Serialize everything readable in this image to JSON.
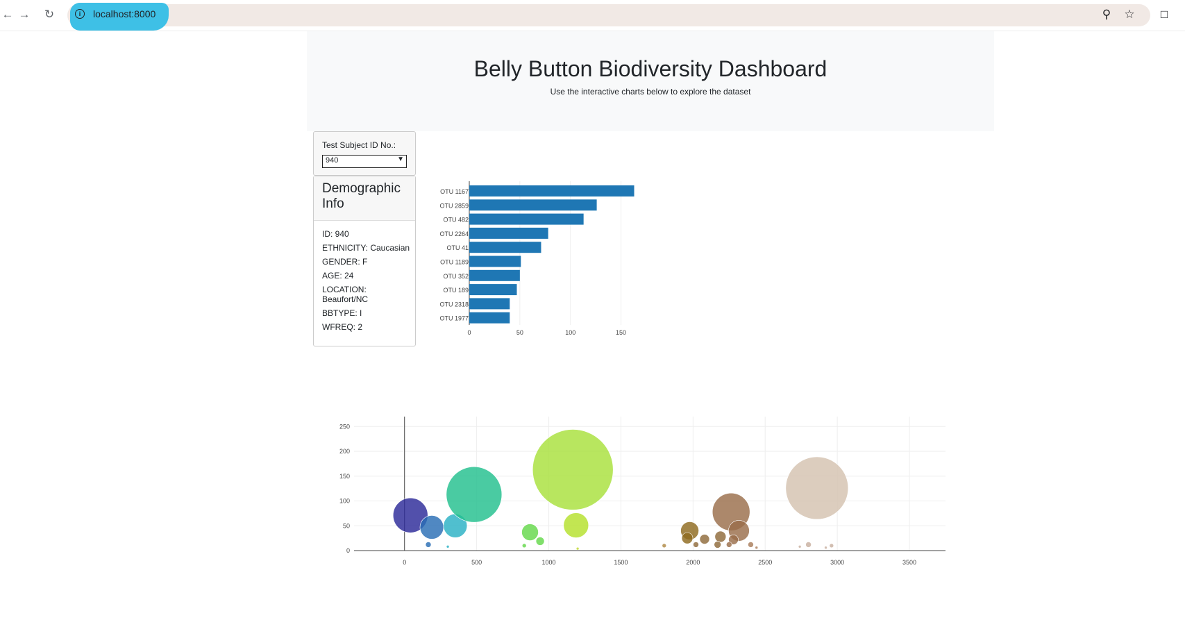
{
  "browser": {
    "url": "localhost:8000",
    "icons": [
      "back-arrow-icon",
      "forward-arrow-icon",
      "reload-icon",
      "site-info-icon",
      "zoom-icon",
      "star-icon",
      "extensions-icon"
    ]
  },
  "header": {
    "title": "Belly Button Biodiversity Dashboard",
    "subtitle": "Use the interactive charts below to explore the dataset"
  },
  "selector": {
    "label": "Test Subject ID No.:",
    "value": "940"
  },
  "demographics": {
    "title": "Demographic Info",
    "rows": [
      "ID: 940",
      "ETHNICITY: Caucasian",
      "GENDER: F",
      "AGE: 24",
      "LOCATION: Beaufort/NC",
      "BBTYPE: I",
      "WFREQ: 2"
    ]
  },
  "chart_data": [
    {
      "type": "bar",
      "orientation": "horizontal",
      "categories": [
        "OTU 1167",
        "OTU 2859",
        "OTU 482",
        "OTU 2264",
        "OTU 41",
        "OTU 1189",
        "OTU 352",
        "OTU 189",
        "OTU 2318",
        "OTU 1977"
      ],
      "values": [
        163,
        126,
        113,
        78,
        71,
        51,
        50,
        47,
        40,
        40
      ],
      "xticks": [
        0,
        50,
        100,
        150
      ],
      "xlim": [
        0,
        175
      ],
      "color": "#1f77b4"
    },
    {
      "type": "scatter",
      "style": "bubble",
      "xticks": [
        0,
        500,
        1000,
        1500,
        2000,
        2500,
        3000,
        3500
      ],
      "yticks": [
        0,
        50,
        100,
        150,
        200,
        250
      ],
      "xlim": [
        -350,
        3750
      ],
      "ylim": [
        0,
        270
      ],
      "points": [
        {
          "x": 41,
          "y": 71,
          "r": 25,
          "color": "#2c2a98"
        },
        {
          "x": 189,
          "y": 47,
          "r": 17,
          "color": "#2a6eb4"
        },
        {
          "x": 352,
          "y": 50,
          "r": 17,
          "color": "#29b1c5"
        },
        {
          "x": 482,
          "y": 113,
          "r": 40,
          "color": "#22c08e"
        },
        {
          "x": 165,
          "y": 12,
          "r": 4,
          "color": "#2a6eb4"
        },
        {
          "x": 300,
          "y": 8,
          "r": 2,
          "color": "#29b1c5"
        },
        {
          "x": 870,
          "y": 37,
          "r": 12,
          "color": "#64d84a"
        },
        {
          "x": 940,
          "y": 19,
          "r": 6,
          "color": "#64d84a"
        },
        {
          "x": 830,
          "y": 10,
          "r": 3,
          "color": "#64d84a"
        },
        {
          "x": 1167,
          "y": 163,
          "r": 58,
          "color": "#a8e03c"
        },
        {
          "x": 1189,
          "y": 51,
          "r": 18,
          "color": "#b4e02c"
        },
        {
          "x": 1200,
          "y": 4,
          "r": 2,
          "color": "#c0d830"
        },
        {
          "x": 1800,
          "y": 10,
          "r": 3,
          "color": "#b08a46"
        },
        {
          "x": 1977,
          "y": 40,
          "r": 13,
          "color": "#8f6a1f"
        },
        {
          "x": 1960,
          "y": 25,
          "r": 8,
          "color": "#8f6a1f"
        },
        {
          "x": 2080,
          "y": 23,
          "r": 7,
          "color": "#8f6a3a"
        },
        {
          "x": 2020,
          "y": 12,
          "r": 4,
          "color": "#8f6a3a"
        },
        {
          "x": 2190,
          "y": 28,
          "r": 8,
          "color": "#8f6a3a"
        },
        {
          "x": 2170,
          "y": 12,
          "r": 5,
          "color": "#8f6a3a"
        },
        {
          "x": 2264,
          "y": 78,
          "r": 27,
          "color": "#9a6e4a"
        },
        {
          "x": 2318,
          "y": 40,
          "r": 15,
          "color": "#9a6e4a"
        },
        {
          "x": 2280,
          "y": 22,
          "r": 7,
          "color": "#9a6e4a"
        },
        {
          "x": 2250,
          "y": 12,
          "r": 4,
          "color": "#9a6e4a"
        },
        {
          "x": 2400,
          "y": 12,
          "r": 4,
          "color": "#a87c5a"
        },
        {
          "x": 2440,
          "y": 6,
          "r": 2,
          "color": "#a87c5a"
        },
        {
          "x": 2859,
          "y": 126,
          "r": 45,
          "color": "#d4c2b0"
        },
        {
          "x": 2800,
          "y": 12,
          "r": 4,
          "color": "#c8b0a0"
        },
        {
          "x": 2740,
          "y": 8,
          "r": 2,
          "color": "#c8b0a0"
        },
        {
          "x": 2960,
          "y": 10,
          "r": 3,
          "color": "#c8b0a0"
        },
        {
          "x": 2920,
          "y": 6,
          "r": 2,
          "color": "#c8b0a0"
        }
      ]
    }
  ]
}
